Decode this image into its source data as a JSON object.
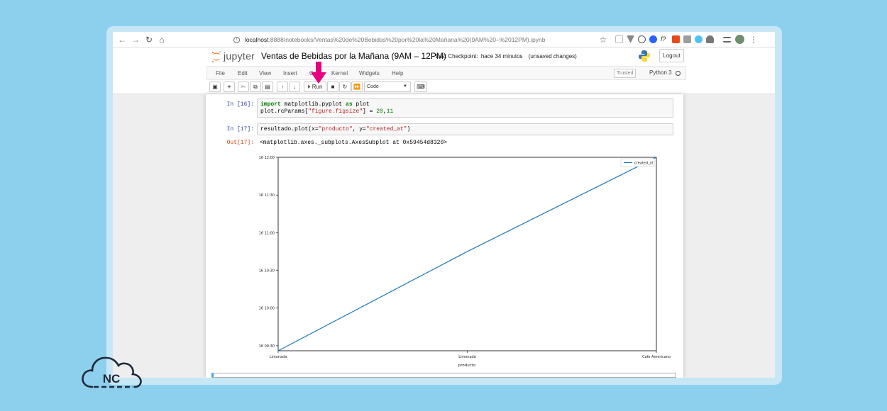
{
  "browser": {
    "url_host": "localhost",
    "url_rest": ":8888/notebooks/Ventas%20de%20Bebidas%20por%20la%20Mañana%20(9AM%20–%2012PM).ipynb"
  },
  "header": {
    "logo_text": "jupyter",
    "notebook_title": "Ventas de Bebidas por la Mañana (9AM – 12PM)",
    "checkpoint_label": "Last Checkpoint:",
    "checkpoint_time": "hace 34 minutos",
    "unsaved": "(unsaved changes)",
    "logout_label": "Logout"
  },
  "menu": {
    "items": [
      "File",
      "Edit",
      "View",
      "Insert",
      "Cell",
      "Kernel",
      "Widgets",
      "Help"
    ],
    "trusted": "Trusted",
    "kernel": "Python 3"
  },
  "toolbar": {
    "run_label": "Run",
    "cell_type": "Code"
  },
  "cells": [
    {
      "prompt": "In [16]:",
      "lines": [
        [
          {
            "t": "import",
            "c": "kw"
          },
          {
            "t": " matplotlib.pyplot ",
            "c": ""
          },
          {
            "t": "as",
            "c": "kw"
          },
          {
            "t": " plot",
            "c": ""
          }
        ],
        [
          {
            "t": "plot.rcParams[",
            "c": ""
          },
          {
            "t": "\"figure.figsize\"",
            "c": "str"
          },
          {
            "t": "] = ",
            "c": ""
          },
          {
            "t": "20",
            "c": "num"
          },
          {
            "t": ",",
            "c": ""
          },
          {
            "t": "11",
            "c": "num"
          }
        ]
      ]
    },
    {
      "prompt": "In [17]:",
      "lines": [
        [
          {
            "t": "resultado.plot(x=",
            "c": ""
          },
          {
            "t": "\"producto\"",
            "c": "str"
          },
          {
            "t": ", y=",
            "c": ""
          },
          {
            "t": "\"created_at\"",
            "c": "str"
          },
          {
            "t": ")",
            "c": ""
          }
        ]
      ]
    }
  ],
  "output": {
    "prompt": "Out[17]:",
    "text": "<matplotlib.axes._subplots.AxesSubplot at 0x59454d8320>"
  },
  "chart_data": {
    "type": "line",
    "xlabel": "producto",
    "ylabel": "",
    "x_tick_labels": [
      "Limonada",
      "Limonada",
      "Cafe Americano"
    ],
    "y_tick_labels": [
      "16 09:30",
      "16 10:00",
      "16 10:30",
      "16 11:00",
      "16 11:30",
      "16 12:00"
    ],
    "series": [
      {
        "name": "created_at",
        "color": "#1f77b4",
        "values": [
          "16 09:26",
          "16 10:45",
          "16 12:00"
        ]
      }
    ],
    "legend": "top-right",
    "grid": false
  },
  "colors": {
    "background": "#8dd0ee",
    "jupyter_orange": "#f37726",
    "arrow": "#e6007e",
    "line": "#1f77b4"
  },
  "icons": [
    "back-icon",
    "forward-icon",
    "reload-icon",
    "home-icon",
    "star-icon",
    "save-icon",
    "plus-icon",
    "cut-icon",
    "copy-icon",
    "paste-icon",
    "arrow-up-icon",
    "arrow-down-icon",
    "run-icon",
    "stop-icon",
    "restart-icon",
    "fast-forward-icon",
    "keyboard-icon",
    "python-icon",
    "nc-cloud-icon"
  ],
  "logo": {
    "text": "NC"
  }
}
